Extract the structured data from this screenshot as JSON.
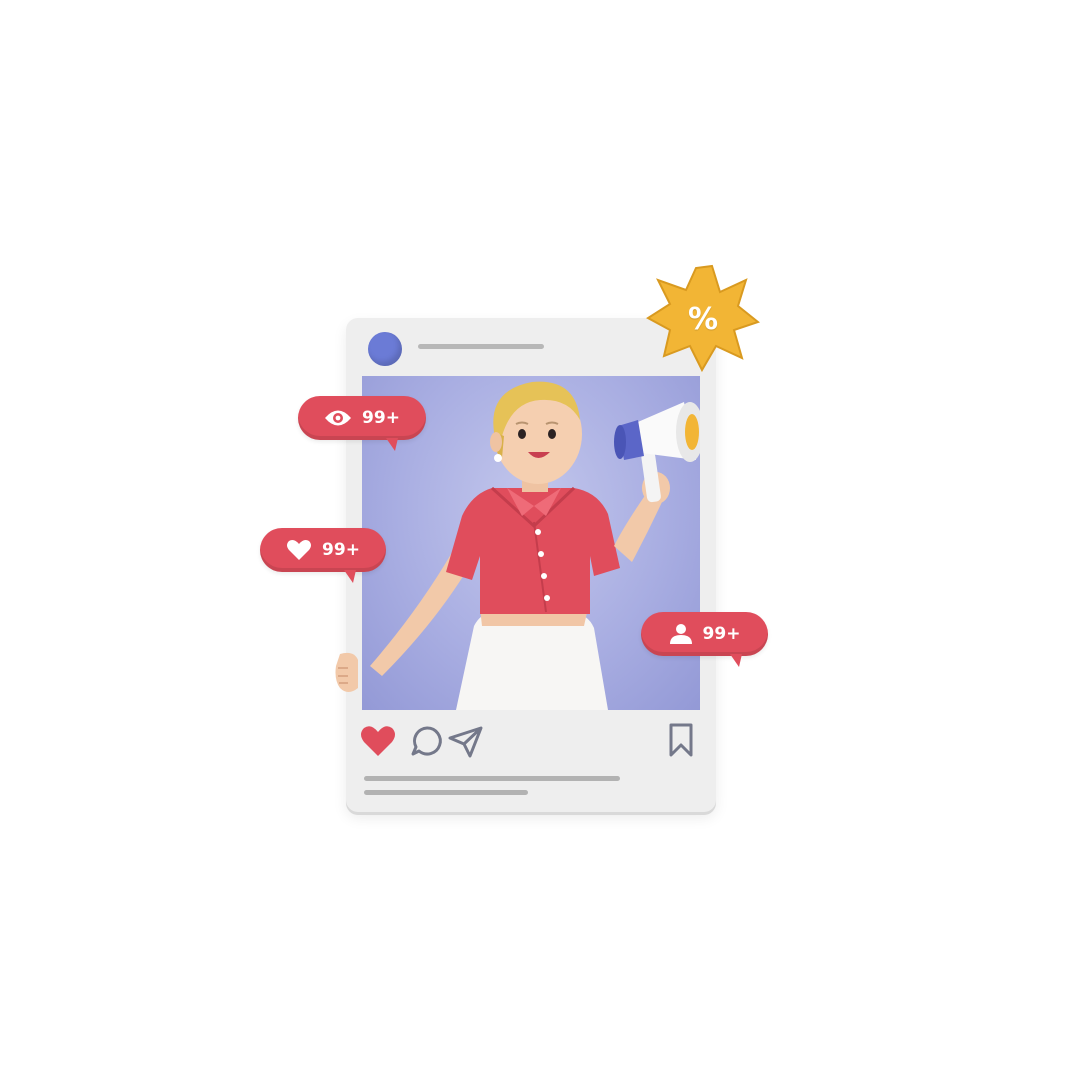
{
  "stats": {
    "views": {
      "icon": "eye-icon",
      "count": "99+"
    },
    "likes": {
      "icon": "heart-icon",
      "count": "99+"
    },
    "followers": {
      "icon": "user-icon",
      "count": "99+"
    }
  },
  "badge": {
    "icon": "discount-starburst-icon",
    "symbol": "%"
  },
  "actions": {
    "like": "heart-filled-icon",
    "comment": "comment-bubble-icon",
    "share": "paper-plane-icon",
    "save": "bookmark-icon"
  },
  "colors": {
    "accent": "#e04d5c",
    "avatar": "#6b7bd6",
    "post_background": "#a9aee2",
    "badge": "#f2b535",
    "card": "#eeeeee"
  }
}
